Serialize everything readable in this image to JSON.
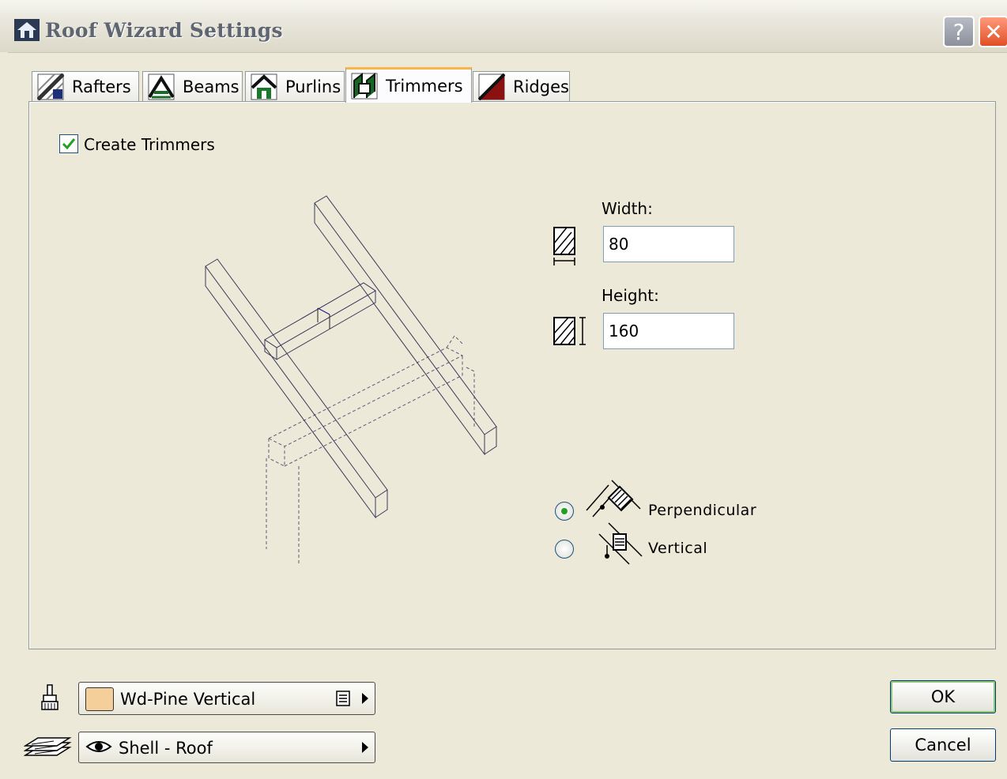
{
  "window": {
    "title": "Roof Wizard Settings",
    "help_glyph": "?",
    "close_glyph": "✕"
  },
  "tabs": [
    {
      "label": "Rafters",
      "icon": "rafters-icon",
      "active": false
    },
    {
      "label": "Beams",
      "icon": "beams-icon",
      "active": false
    },
    {
      "label": "Purlins",
      "icon": "purlins-icon",
      "active": false
    },
    {
      "label": "Trimmers",
      "icon": "trimmers-icon",
      "active": true
    },
    {
      "label": "Ridges",
      "icon": "ridges-icon",
      "active": false
    }
  ],
  "trimmers": {
    "create_label": "Create Trimmers",
    "create_checked": true,
    "width_label": "Width:",
    "width_value": "80",
    "height_label": "Height:",
    "height_value": "160",
    "orientation_options": [
      {
        "label": "Perpendicular",
        "selected": true
      },
      {
        "label": "Vertical",
        "selected": false
      }
    ]
  },
  "bottom": {
    "material": "Wd-Pine Vertical",
    "material_swatch_color": "#f5cf9a",
    "layer": "Shell - Roof",
    "ok_label": "OK",
    "cancel_label": "Cancel"
  },
  "colors": {
    "dialog_bg": "#ece9d8",
    "tab_accent": "#f7b54a",
    "radio_dot": "#21a121",
    "input_border": "#7f9db9"
  }
}
